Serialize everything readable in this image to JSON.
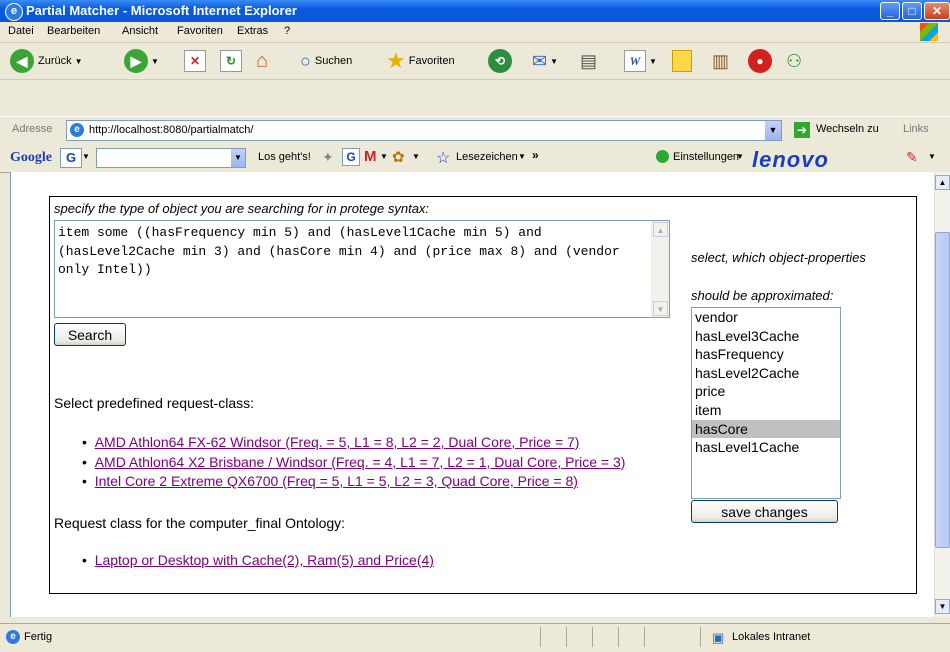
{
  "window": {
    "title": "Partial Matcher - Microsoft Internet Explorer"
  },
  "menu": [
    "Datei",
    "Bearbeiten",
    "Ansicht",
    "Favoriten",
    "Extras",
    "?"
  ],
  "toolbar": {
    "back_label": "Zurück",
    "search_label": "Suchen",
    "favorites_label": "Favoriten"
  },
  "address": {
    "label": "Adresse",
    "url": "http://localhost:8080/partialmatch/",
    "go_label": "Wechseln zu",
    "links_label": "Links"
  },
  "google_bar": {
    "logo": "Google",
    "search_button": "Los geht's!",
    "bookmarks_label": "Lesezeichen",
    "settings_label": "Einstellungen",
    "brand": "lenovo"
  },
  "page": {
    "query_prompt": "specify the type of object you are searching for in protege syntax:",
    "query_value": "item some ((hasFrequency min 5) and (hasLevel1Cache min 5) and (hasLevel2Cache min 3) and (hasCore min 4) and (price max 8) and (vendor only Intel))",
    "search_button": "Search",
    "predefined_heading": "Select predefined request-class:",
    "predefined_links": [
      "AMD Athlon64 FX-62 Windsor (Freq. = 5, L1 = 8, L2 = 2, Dual Core, Price = 7)",
      "AMD Athlon64 X2 Brisbane / Windsor (Freq. = 4, L1 = 7, L2 = 1, Dual Core, Price = 3)",
      "Intel Core 2 Extreme QX6700 (Freq = 5, L1 = 5, L2 = 3, Quad Core, Price = 8)"
    ],
    "ontology_heading": "Request class for the computer_final Ontology:",
    "ontology_links": [
      "Laptop or Desktop with Cache(2), Ram(5) and Price(4)"
    ],
    "properties_prompt_1": "select, which object-properties",
    "properties_prompt_2": "should be approximated:",
    "properties": [
      "vendor",
      "hasLevel3Cache",
      "hasFrequency",
      "hasLevel2Cache",
      "price",
      "item",
      "hasCore",
      "hasLevel1Cache"
    ],
    "selected_property": "hasCore",
    "save_button": "save changes"
  },
  "status": {
    "text": "Fertig",
    "zone": "Lokales Intranet"
  }
}
